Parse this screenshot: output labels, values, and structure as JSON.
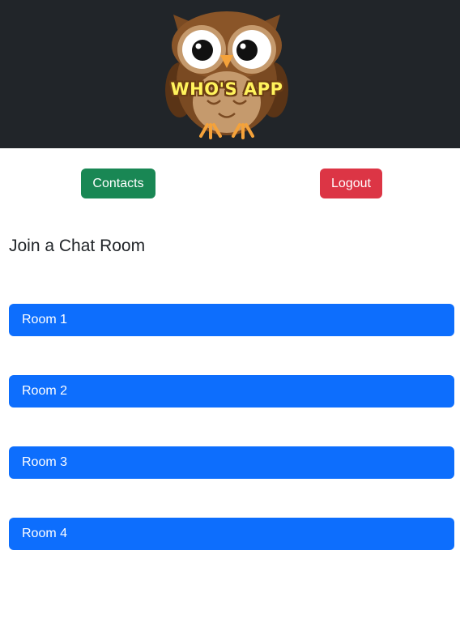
{
  "header": {
    "logo_text": "WHO'S APP",
    "logo_icon": "owl-icon"
  },
  "nav": {
    "contacts_label": "Contacts",
    "logout_label": "Logout"
  },
  "main": {
    "heading": "Join a Chat Room",
    "rooms": [
      {
        "label": "Room 1"
      },
      {
        "label": "Room 2"
      },
      {
        "label": "Room 3"
      },
      {
        "label": "Room 4"
      }
    ]
  },
  "colors": {
    "header_bg": "#212529",
    "contacts": "#198754",
    "logout": "#dc3545",
    "room": "#0d6efd"
  }
}
